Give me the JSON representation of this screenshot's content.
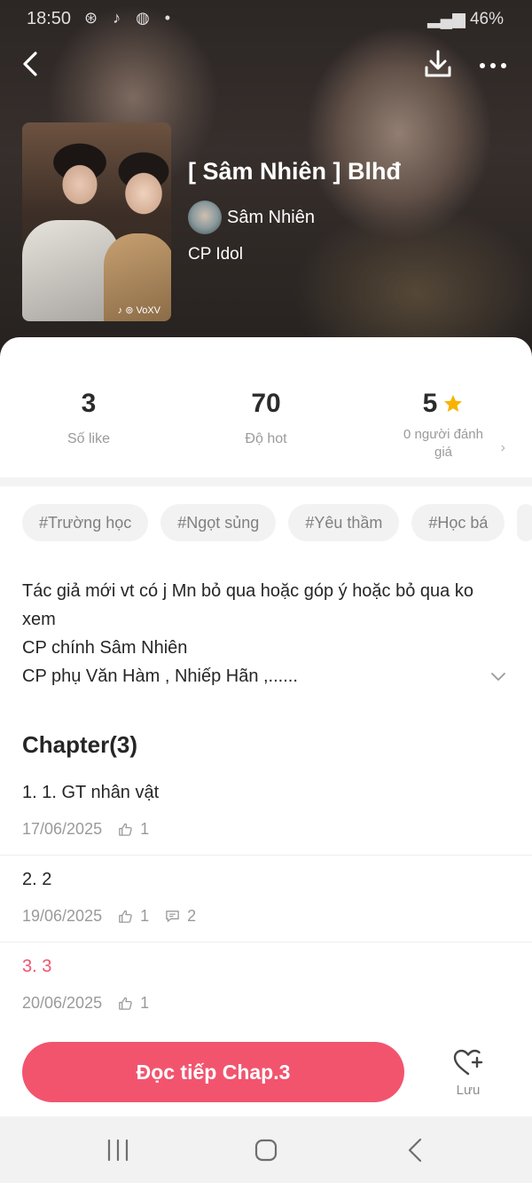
{
  "status_bar": {
    "time": "18:50",
    "icons": [
      "weibo-icon",
      "tiktok-icon",
      "messenger-icon",
      "dot"
    ],
    "battery": "46%"
  },
  "story": {
    "title": "[ Sâm Nhiên ] Blhđ",
    "author": "Sâm Nhiên",
    "category": "CP Idol",
    "cover_watermark": "♪ ⊚ VoXV"
  },
  "stats": {
    "likes": {
      "value": "3",
      "label": "Số like"
    },
    "hot": {
      "value": "70",
      "label": "Độ hot"
    },
    "rating": {
      "value": "5",
      "label": "0 người đánh giá"
    }
  },
  "tags": [
    "#Trường học",
    "#Ngọt sủng",
    "#Yêu thầm",
    "#Học bá"
  ],
  "description": [
    "Tác giả mới vt có j Mn bỏ qua hoặc góp ý hoặc bỏ qua ko xem",
    "CP chính Sâm Nhiên",
    "CP phụ Văn Hàm , Nhiếp Hãn ,......"
  ],
  "chapter_header": "Chapter(3)",
  "chapters": [
    {
      "title": "1. 1. GT nhân vật",
      "date": "17/06/2025",
      "likes": "1",
      "comments": ""
    },
    {
      "title": "2. 2",
      "date": "19/06/2025",
      "likes": "1",
      "comments": "2"
    },
    {
      "title": "3. 3",
      "date": "20/06/2025",
      "likes": "1",
      "comments": ""
    }
  ],
  "actions": {
    "continue_label": "Đọc tiếp Chap.3",
    "save_label": "Lưu"
  },
  "colors": {
    "accent": "#f2546e",
    "star": "#f6b400",
    "tag_bg": "#f2f2f2"
  }
}
